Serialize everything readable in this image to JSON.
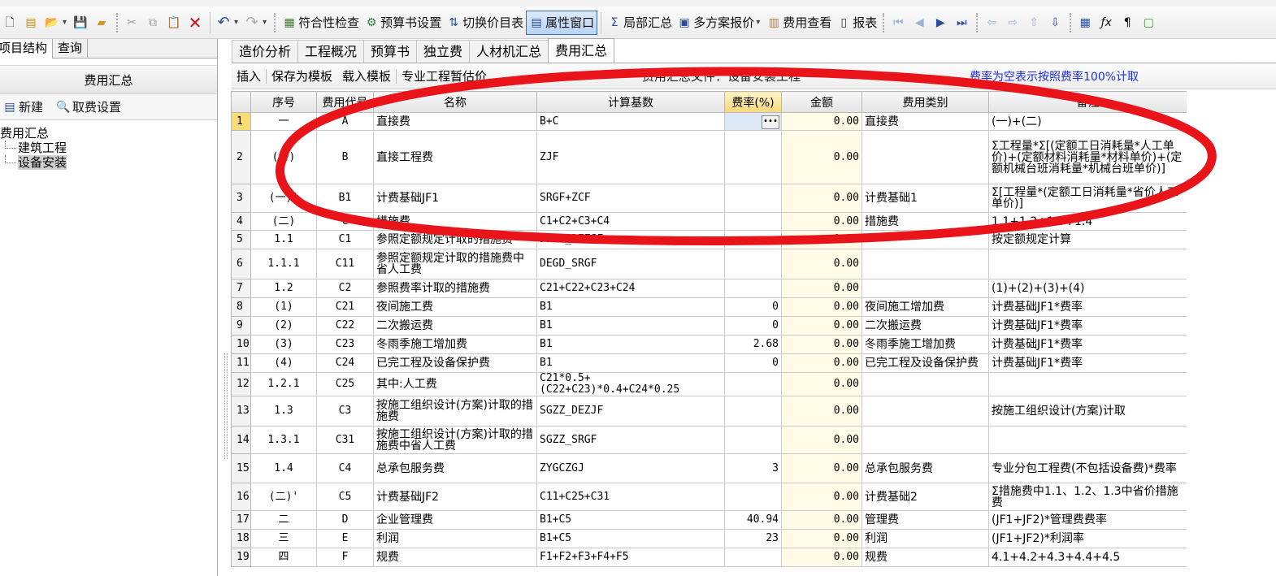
{
  "toolbar": {
    "buttons": [
      "符合性检查",
      "预算书设置",
      "切换价目表",
      "属性窗口",
      "局部汇总",
      "多方案报价",
      "费用查看",
      "报表"
    ]
  },
  "left": {
    "tabs": [
      "项目结构",
      "查询"
    ],
    "header": "费用汇总",
    "new_label": "新建",
    "fee_setting_label": "取费设置",
    "tree_root": "费用汇总",
    "tree_children": [
      "建筑工程",
      "设备安装"
    ]
  },
  "tabs": [
    "造价分析",
    "工程概况",
    "预算书",
    "独立费",
    "人材机汇总",
    "费用汇总"
  ],
  "subtoolbar": {
    "insert": "插入",
    "save_template": "保存为模板",
    "load_template": "载入模板",
    "provisional": "专业工程暂估价",
    "file_label": "费用汇总文件：设备安装工程",
    "rate_note": "费率为空表示按照费率100%计取"
  },
  "columns": [
    "序号",
    "费用代号",
    "名称",
    "计算基数",
    "费率(%)",
    "金额",
    "费用类别",
    "备注"
  ],
  "rows": [
    {
      "n": "1",
      "seq": "一",
      "code": "A",
      "name": "直接费",
      "base": "B+C",
      "rate": "",
      "amt": "0.00",
      "cat": "直接费",
      "note": "(一)+(二)"
    },
    {
      "n": "2",
      "seq": "(一)",
      "code": "B",
      "name": "直接工程费",
      "base": "ZJF",
      "rate": "",
      "amt": "0.00",
      "cat": "",
      "note": "Σ工程量*Σ[(定额工日消耗量*人工单价)+(定额材料消耗量*材料单价)+(定额机械台班消耗量*机械台班单价)]"
    },
    {
      "n": "3",
      "seq": "(一)'",
      "code": "B1",
      "name": "计费基础JF1",
      "base": "SRGF+ZCF",
      "rate": "",
      "amt": "0.00",
      "cat": "计费基础1",
      "note": "Σ[工程量*(定额工日消耗量*省价人工单价)]"
    },
    {
      "n": "4",
      "seq": "(二)",
      "code": "C",
      "name": "措施费",
      "base": "C1+C2+C3+C4",
      "rate": "",
      "amt": "0.00",
      "cat": "措施费",
      "note": "1.1+1.2+1.3+1.4"
    },
    {
      "n": "5",
      "seq": "1.1",
      "code": "C1",
      "name": "参照定额规定计取的措施费",
      "base": "DEGD_DEZJF",
      "rate": "",
      "amt": "0.00",
      "cat": "",
      "note": "按定额规定计算"
    },
    {
      "n": "6",
      "seq": "1.1.1",
      "code": "C11",
      "name": "参照定额规定计取的措施费中省人工费",
      "base": "DEGD_SRGF",
      "rate": "",
      "amt": "0.00",
      "cat": "",
      "note": ""
    },
    {
      "n": "7",
      "seq": "1.2",
      "code": "C2",
      "name": "参照费率计取的措施费",
      "base": "C21+C22+C23+C24",
      "rate": "",
      "amt": "0.00",
      "cat": "",
      "note": "(1)+(2)+(3)+(4)"
    },
    {
      "n": "8",
      "seq": "(1)",
      "code": "C21",
      "name": "夜间施工费",
      "base": "B1",
      "rate": "0",
      "amt": "0.00",
      "cat": "夜间施工增加费",
      "note": "计费基础JF1*费率"
    },
    {
      "n": "9",
      "seq": "(2)",
      "code": "C22",
      "name": "二次搬运费",
      "base": "B1",
      "rate": "0",
      "amt": "0.00",
      "cat": "二次搬运费",
      "note": "计费基础JF1*费率"
    },
    {
      "n": "10",
      "seq": "(3)",
      "code": "C23",
      "name": "冬雨季施工增加费",
      "base": "B1",
      "rate": "2.68",
      "amt": "0.00",
      "cat": "冬雨季施工增加费",
      "note": "计费基础JF1*费率"
    },
    {
      "n": "11",
      "seq": "(4)",
      "code": "C24",
      "name": "已完工程及设备保护费",
      "base": "B1",
      "rate": "0",
      "amt": "0.00",
      "cat": "已完工程及设备保护费",
      "note": "计费基础JF1*费率"
    },
    {
      "n": "12",
      "seq": "1.2.1",
      "code": "C25",
      "name": "其中:人工费",
      "base": "C21*0.5+(C22+C23)*0.4+C24*0.25",
      "rate": "",
      "amt": "0.00",
      "cat": "",
      "note": ""
    },
    {
      "n": "13",
      "seq": "1.3",
      "code": "C3",
      "name": "按施工组织设计(方案)计取的措施费",
      "base": "SGZZ_DEZJF",
      "rate": "",
      "amt": "0.00",
      "cat": "",
      "note": "按施工组织设计(方案)计取"
    },
    {
      "n": "14",
      "seq": "1.3.1",
      "code": "C31",
      "name": "按施工组织设计(方案)计取的措施费中省人工费",
      "base": "SGZZ_SRGF",
      "rate": "",
      "amt": "0.00",
      "cat": "",
      "note": ""
    },
    {
      "n": "15",
      "seq": "1.4",
      "code": "C4",
      "name": "总承包服务费",
      "base": "ZYGCZGJ",
      "rate": "3",
      "amt": "0.00",
      "cat": "总承包服务费",
      "note": "专业分包工程费(不包括设备费)*费率"
    },
    {
      "n": "16",
      "seq": "(二)'",
      "code": "C5",
      "name": "计费基础JF2",
      "base": "C11+C25+C31",
      "rate": "",
      "amt": "0.00",
      "cat": "计费基础2",
      "note": "Σ措施费中1.1、1.2、1.3中省价措施费"
    },
    {
      "n": "17",
      "seq": "二",
      "code": "D",
      "name": "企业管理费",
      "base": "B1+C5",
      "rate": "40.94",
      "amt": "0.00",
      "cat": "管理费",
      "note": "(JF1+JF2)*管理费费率"
    },
    {
      "n": "18",
      "seq": "三",
      "code": "E",
      "name": "利润",
      "base": "B1+C5",
      "rate": "23",
      "amt": "0.00",
      "cat": "利润",
      "note": "(JF1+JF2)*利润率"
    },
    {
      "n": "19",
      "seq": "四",
      "code": "F",
      "name": "规费",
      "base": "F1+F2+F3+F4+F5",
      "rate": "",
      "amt": "0.00",
      "cat": "规费",
      "note": "4.1+4.2+4.3+4.4+4.5"
    }
  ],
  "colors": {
    "annotation": "#e8141a",
    "note_link": "#1d2fd6",
    "rate_header": "#f7d77c"
  },
  "icons": [
    "new-file-icon",
    "open-folder-icon",
    "save-icon",
    "cut-icon",
    "copy-icon",
    "paste-icon",
    "delete-x-icon",
    "undo-icon",
    "redo-icon",
    "calculator-icon",
    "formula-icon",
    "paragraph-icon"
  ]
}
